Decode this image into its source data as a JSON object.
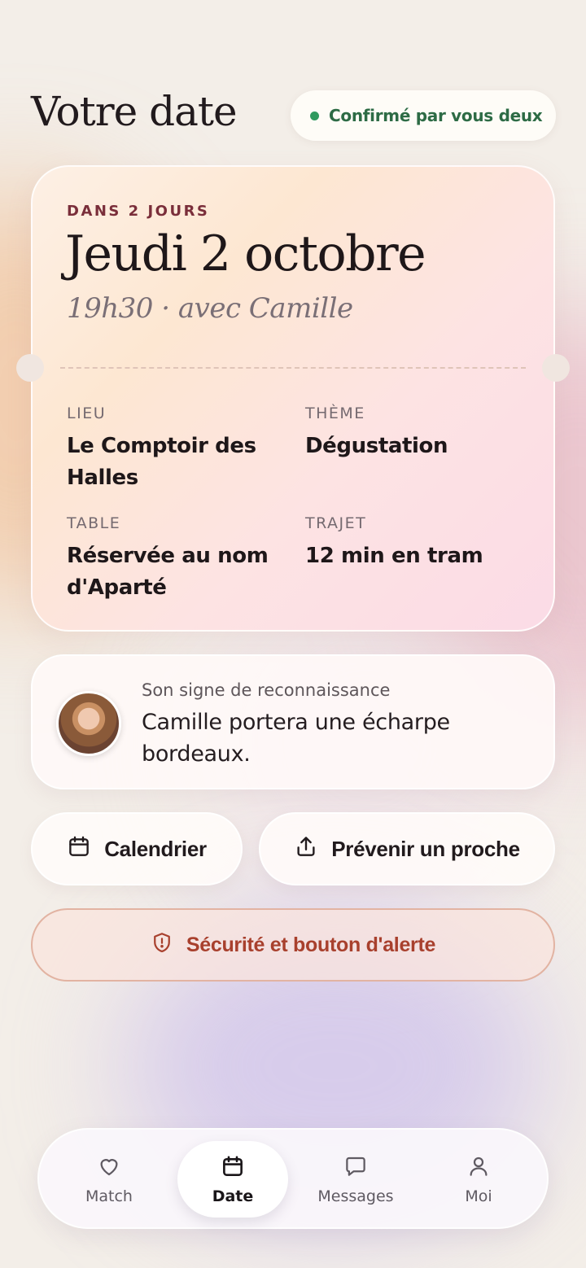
{
  "header": {
    "title": "Votre date",
    "status": "Confirmé par vous deux",
    "status_color": "#2f9a5f"
  },
  "ticket": {
    "eyebrow": "DANS 2 JOURS",
    "date": "Jeudi 2 octobre",
    "subtitle": "19h30 · avec Camille",
    "fields": [
      {
        "label": "LIEU",
        "value": "Le Comptoir des Halles"
      },
      {
        "label": "THÈME",
        "value": "Dégustation"
      },
      {
        "label": "TABLE",
        "value": "Réservée au nom d'Aparté"
      },
      {
        "label": "TRAJET",
        "value": "12 min en tram"
      }
    ]
  },
  "sign": {
    "label": "Son signe de reconnaissance",
    "text": "Camille portera une écharpe bordeaux.",
    "avatar_icon": "avatar-photo"
  },
  "actions": {
    "calendar_label": "Calendrier",
    "calendar_icon": "calendar-icon",
    "share_label": "Prévenir un proche",
    "share_icon": "share-icon",
    "safety_label": "Sécurité et bouton d'alerte",
    "safety_icon": "shield-alert-icon",
    "safety_color": "#a8402d"
  },
  "tabs": [
    {
      "label": "Match",
      "icon": "heart-icon"
    },
    {
      "label": "Date",
      "icon": "calendar-icon",
      "active": true
    },
    {
      "label": "Messages",
      "icon": "message-icon"
    },
    {
      "label": "Moi",
      "icon": "user-icon"
    }
  ]
}
